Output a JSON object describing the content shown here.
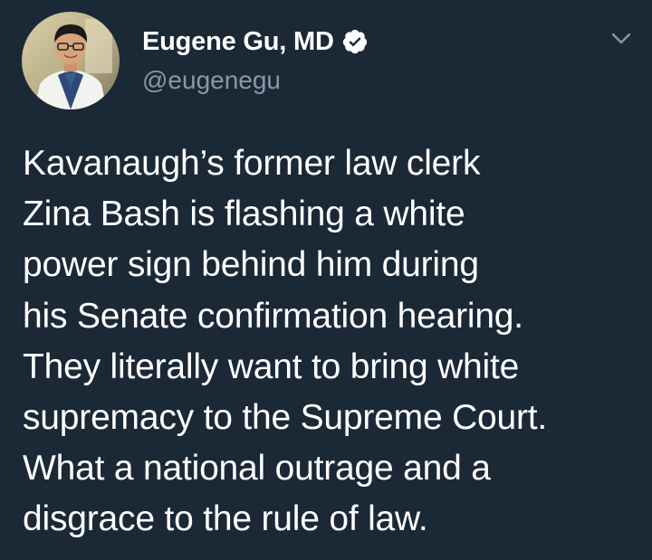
{
  "author": {
    "display_name": "Eugene Gu, MD",
    "handle": "@eugenegu",
    "verified": true,
    "verified_icon": "verified-badge-icon",
    "avatar_icon": "profile-photo"
  },
  "menu": {
    "icon": "chevron-down-icon"
  },
  "tweet": {
    "lines": [
      "Kavanaugh’s former law clerk",
      "Zina Bash is flashing a white",
      "power sign behind him during",
      "his Senate confirmation hearing.",
      "They literally want to bring white",
      "supremacy to the Supreme Court.",
      "What a national outrage and a",
      "disgrace to the rule of law."
    ]
  },
  "colors": {
    "background": "#1b2836",
    "text": "#ffffff",
    "secondary_text": "#8899a6"
  }
}
